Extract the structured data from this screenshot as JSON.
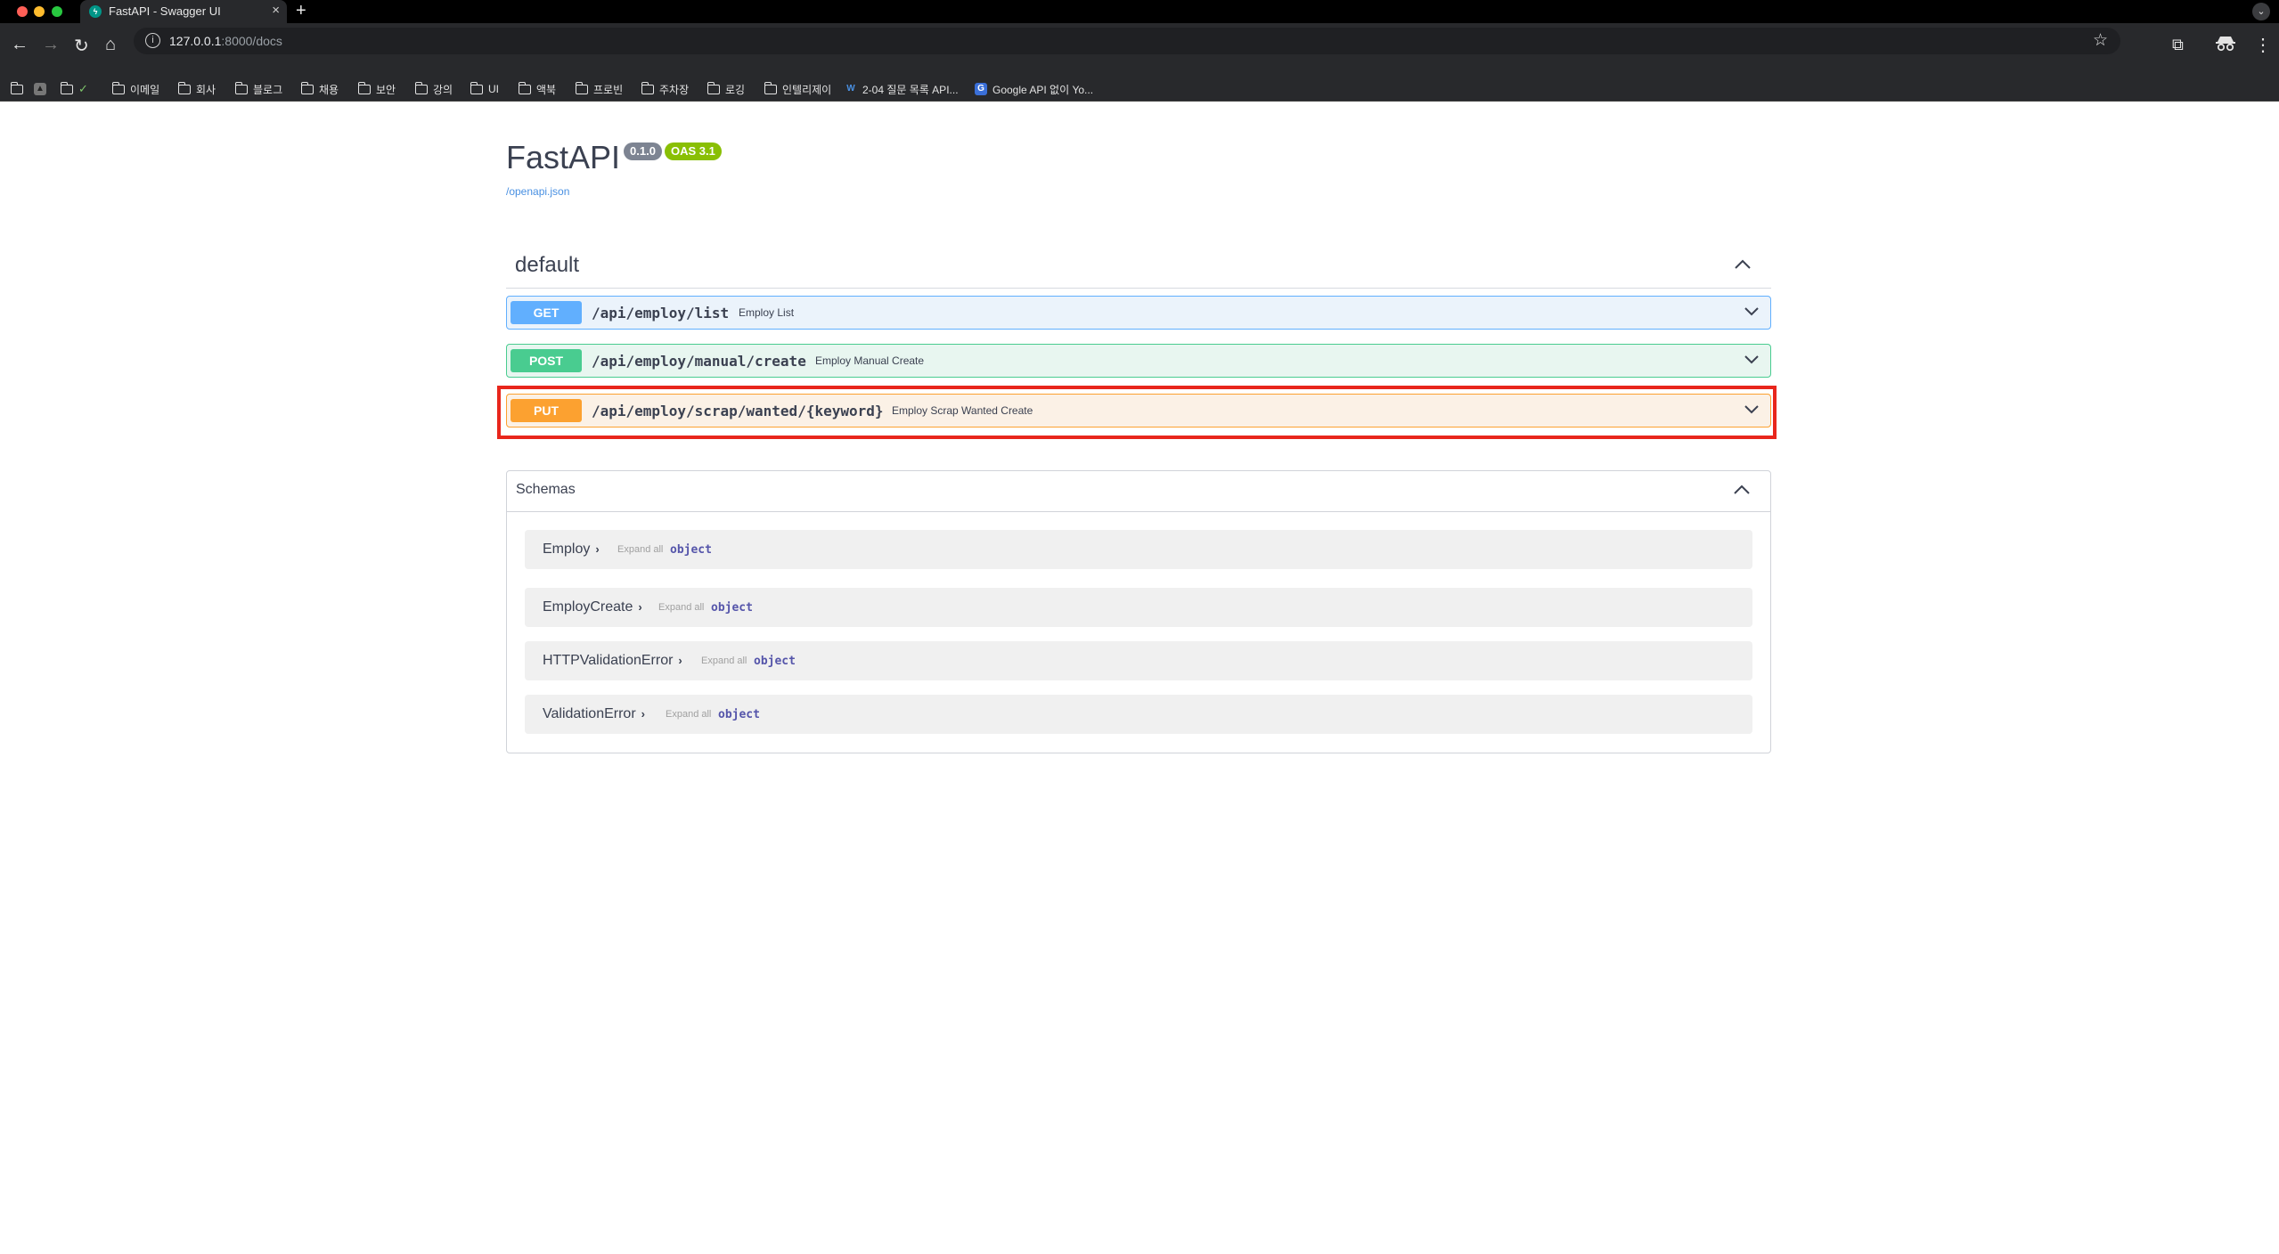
{
  "browser": {
    "tab_title": "FastAPI - Swagger UI",
    "url_host": "127.0.0.1",
    "url_rest": ":8000/docs",
    "bookmarks": [
      {
        "label": "",
        "icon": "folder-icon"
      },
      {
        "label": "",
        "icon": "apps-icon"
      },
      {
        "label": "",
        "icon": "folder-icon"
      },
      {
        "label": "이메일",
        "icon": "folder-icon"
      },
      {
        "label": "회사",
        "icon": "folder-icon"
      },
      {
        "label": "블로그",
        "icon": "folder-icon"
      },
      {
        "label": "채용",
        "icon": "folder-icon"
      },
      {
        "label": "보안",
        "icon": "folder-icon"
      },
      {
        "label": "강의",
        "icon": "folder-icon"
      },
      {
        "label": "UI",
        "icon": "folder-icon"
      },
      {
        "label": "액북",
        "icon": "folder-icon"
      },
      {
        "label": "프로빈",
        "icon": "folder-icon"
      },
      {
        "label": "주차장",
        "icon": "folder-icon"
      },
      {
        "label": "로깅",
        "icon": "folder-icon"
      },
      {
        "label": "인텔리제이",
        "icon": "folder-icon"
      },
      {
        "label": "2-04 질문 목록 API...",
        "icon": "wikidocs-icon"
      },
      {
        "label": "Google API 없이 Yo...",
        "icon": "google-icon"
      }
    ]
  },
  "info": {
    "title": "FastAPI",
    "version": "0.1.0",
    "oas": "OAS 3.1",
    "spec_link": "/openapi.json"
  },
  "tag": {
    "name": "default"
  },
  "operations": [
    {
      "method": "GET",
      "path": "/api/employ/list",
      "summary": "Employ List",
      "color": "#61affe"
    },
    {
      "method": "POST",
      "path": "/api/employ/manual/create",
      "summary": "Employ Manual Create",
      "color": "#49cc90"
    },
    {
      "method": "PUT",
      "path": "/api/employ/scrap/wanted/{keyword}",
      "summary": "Employ Scrap Wanted Create",
      "color": "#fca130"
    }
  ],
  "highlight_color": "#e8261c",
  "schemas": {
    "title": "Schemas",
    "models": [
      {
        "name": "Employ",
        "expand": "Expand all",
        "type": "object"
      },
      {
        "name": "EmployCreate",
        "expand": "Expand all",
        "type": "object"
      },
      {
        "name": "HTTPValidationError",
        "expand": "Expand all",
        "type": "object"
      },
      {
        "name": "ValidationError",
        "expand": "Expand all",
        "type": "object"
      }
    ]
  }
}
